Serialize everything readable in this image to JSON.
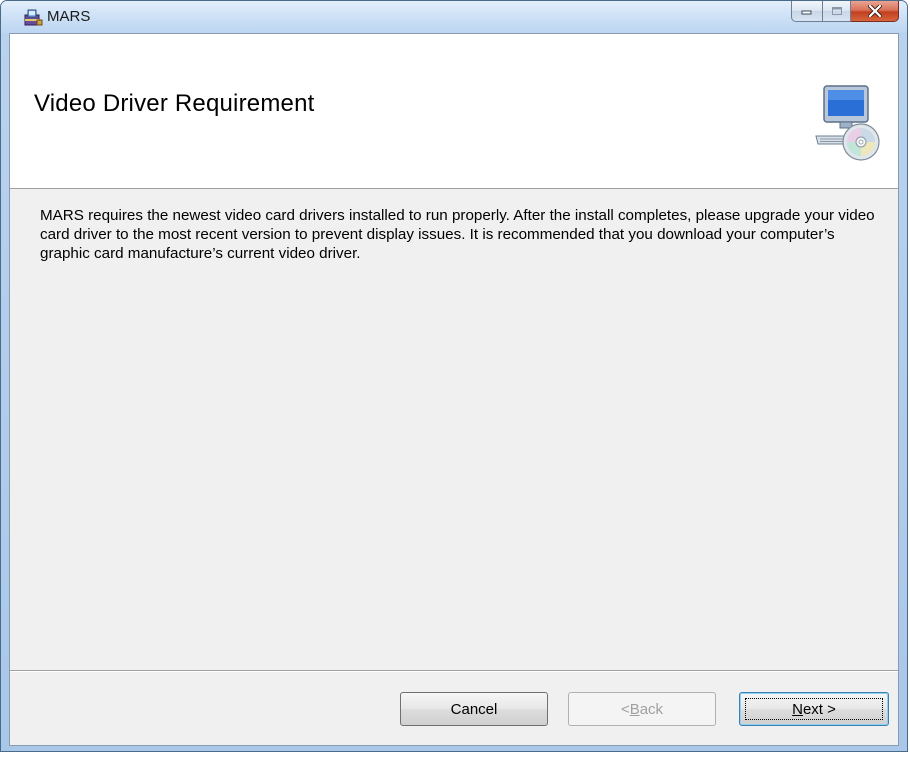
{
  "window": {
    "title": "MARS",
    "icon": "installer-package-icon"
  },
  "caption_buttons": {
    "minimize_icon": "minimize-icon",
    "maximize_icon": "maximize-icon",
    "close_icon": "close-icon"
  },
  "banner": {
    "title": "Video Driver Requirement",
    "icon": "computer-cd-icon"
  },
  "body": {
    "message": "MARS requires the newest video card drivers installed to run properly.  After the install completes, please upgrade your video card driver to the most recent version to prevent display issues. It is recommended that you download your computer’s graphic card manufacture’s current video driver."
  },
  "buttons": {
    "cancel_label": "Cancel",
    "back_prefix": "< ",
    "back_mnemonic": "B",
    "back_rest": "ack",
    "back_enabled": false,
    "next_mnemonic": "N",
    "next_rest": "ext >",
    "next_enabled": true
  },
  "colors": {
    "client_background": "#f0f0f0",
    "banner_background": "#ffffff",
    "close_button": "#c2401f"
  }
}
